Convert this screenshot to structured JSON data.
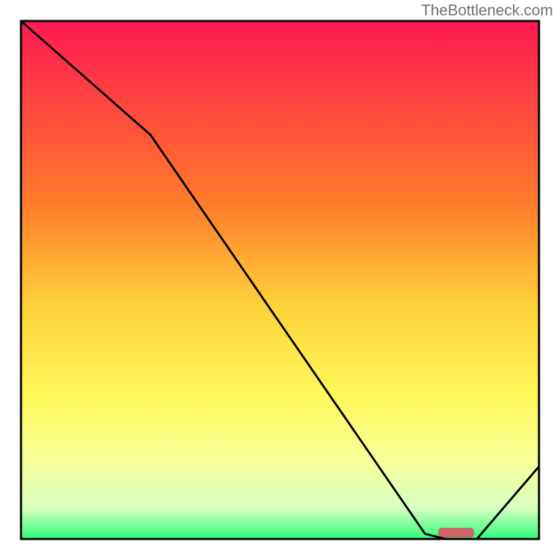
{
  "watermark": "TheBottleneck.com",
  "chart_data": {
    "type": "line",
    "title": "",
    "xlabel": "",
    "ylabel": "",
    "xlim": [
      0,
      100
    ],
    "ylim": [
      0,
      100
    ],
    "x": [
      0,
      25,
      78,
      82,
      88,
      100
    ],
    "values": [
      100,
      78,
      1,
      0,
      0,
      14
    ],
    "marker": {
      "x_center": 84,
      "width_pct": 7
    },
    "gradient_stops": [
      {
        "offset": 0,
        "color": "#ff1a52"
      },
      {
        "offset": 35,
        "color": "#ff7a2a"
      },
      {
        "offset": 55,
        "color": "#ffd23a"
      },
      {
        "offset": 72,
        "color": "#fff85a"
      },
      {
        "offset": 85,
        "color": "#f6ff9a"
      },
      {
        "offset": 94,
        "color": "#d9ffc0"
      },
      {
        "offset": 100,
        "color": "#2cff7a"
      }
    ],
    "colors": {
      "frame": "#000000",
      "line": "#000000",
      "marker": "#cc6666"
    }
  }
}
